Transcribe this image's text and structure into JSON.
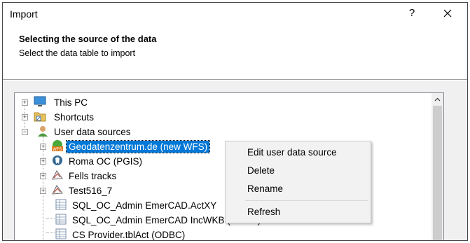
{
  "window": {
    "title": "Import",
    "help_label": "?"
  },
  "header": {
    "title": "Selecting the source of the data",
    "subtitle": "Select the data table to import"
  },
  "tree": {
    "items": [
      {
        "label": "This PC",
        "icon": "computer-icon"
      },
      {
        "label": "Shortcuts",
        "icon": "shortcut-folder-icon"
      },
      {
        "label": "User data sources",
        "icon": "user-icon"
      },
      {
        "label": "Geodatenzentrum.de (new WFS)",
        "icon": "wfs-globe-icon",
        "selected": true
      },
      {
        "label": "Roma OC (PGIS)",
        "icon": "database-elephant-icon"
      },
      {
        "label": "Fells tracks",
        "icon": "tracks-icon"
      },
      {
        "label": "Test516_7",
        "icon": "tracks-icon"
      },
      {
        "label": "SQL_OC_Admin EmerCAD.ActXY",
        "icon": "table-icon"
      },
      {
        "label": "SQL_OC_Admin EmerCAD IncWKB (ODBC)",
        "icon": "table-icon"
      },
      {
        "label": "CS Provider.tblAct (ODBC)",
        "icon": "table-icon"
      }
    ]
  },
  "context_menu": {
    "items": [
      {
        "label": "Edit user data source"
      },
      {
        "label": "Delete"
      },
      {
        "label": "Rename"
      },
      {
        "label": "Refresh"
      }
    ]
  },
  "colors": {
    "selection": "#0078d7",
    "menu_background": "#f2f2f2"
  }
}
